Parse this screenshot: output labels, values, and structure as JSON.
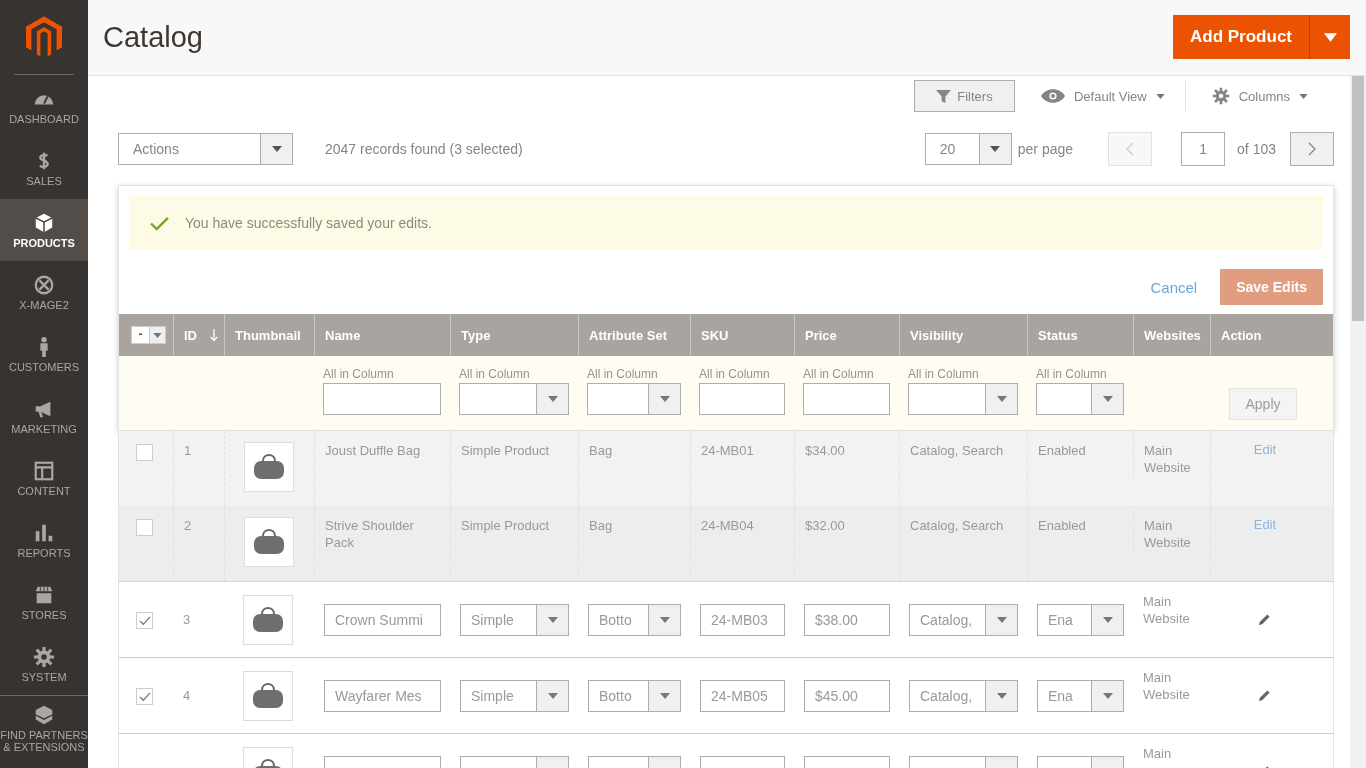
{
  "sidebar": {
    "items": [
      {
        "label": "DASHBOARD",
        "selected": false
      },
      {
        "label": "SALES",
        "selected": false
      },
      {
        "label": "PRODUCTS",
        "selected": true
      },
      {
        "label": "X-MAGE2",
        "selected": false
      },
      {
        "label": "CUSTOMERS",
        "selected": false
      },
      {
        "label": "MARKETING",
        "selected": false
      },
      {
        "label": "CONTENT",
        "selected": false
      },
      {
        "label": "REPORTS",
        "selected": false
      },
      {
        "label": "STORES",
        "selected": false
      },
      {
        "label": "SYSTEM",
        "selected": false
      },
      {
        "label": "FIND PARTNERS & EXTENSIONS",
        "selected": false
      }
    ]
  },
  "header": {
    "title": "Catalog",
    "add_button": "Add Product"
  },
  "toolbar": {
    "filters": "Filters",
    "view": "Default View",
    "columns": "Columns"
  },
  "actions": {
    "placeholder": "Actions",
    "records": "2047 records found (3 selected)"
  },
  "pager": {
    "per_page": "20",
    "per_page_label": "per page",
    "prev_disabled": true,
    "page": "1",
    "of": "of 103"
  },
  "edit_panel": {
    "message": "You have successfully saved your edits.",
    "cancel": "Cancel",
    "save": "Save Edits"
  },
  "grid": {
    "mass_select": "-",
    "apply": "Apply",
    "apply_disabled": true,
    "columns": [
      {
        "label": "ID",
        "sorted": true,
        "kind": "plain"
      },
      {
        "label": "Thumbnail",
        "sorted": false,
        "kind": "plain"
      },
      {
        "label": "Name",
        "sorted": false,
        "kind": "text",
        "filter_label": "All in Column"
      },
      {
        "label": "Type",
        "sorted": false,
        "kind": "select",
        "filter_label": "All in Column"
      },
      {
        "label": "Attribute Set",
        "sorted": false,
        "kind": "select",
        "filter_label": "All in Column"
      },
      {
        "label": "SKU",
        "sorted": false,
        "kind": "text",
        "filter_label": "All in Column"
      },
      {
        "label": "Price",
        "sorted": false,
        "kind": "text",
        "filter_label": "All in Column"
      },
      {
        "label": "Visibility",
        "sorted": false,
        "kind": "select",
        "filter_label": "All in Column"
      },
      {
        "label": "Status",
        "sorted": false,
        "kind": "select",
        "filter_label": "All in Column"
      },
      {
        "label": "Websites",
        "sorted": false,
        "kind": "plain"
      },
      {
        "label": "Action",
        "sorted": false,
        "kind": "plain"
      }
    ],
    "rows": [
      {
        "kind": "view",
        "checked": false,
        "id": "1",
        "cells": [
          "Joust Duffle Bag",
          "Simple Product",
          "Bag",
          "24-MB01",
          "$34.00",
          "Catalog, Search",
          "Enabled"
        ],
        "websites": "Main Website",
        "action": "Edit"
      },
      {
        "kind": "view",
        "checked": false,
        "id": "2",
        "cells": [
          "Strive Shoulder Pack",
          "Simple Product",
          "Bag",
          "24-MB04",
          "$32.00",
          "Catalog, Search",
          "Enabled"
        ],
        "websites": "Main Website",
        "action": "Edit"
      },
      {
        "kind": "edit",
        "checked": true,
        "id": "3",
        "cells": [
          "Crown Summi",
          "Simple",
          "Botto",
          "24-MB03",
          "$38.00",
          "Catalog,",
          "Ena"
        ],
        "websites": "Main Website"
      },
      {
        "kind": "edit",
        "checked": true,
        "id": "4",
        "cells": [
          "Wayfarer Mes",
          "Simple",
          "Botto",
          "24-MB05",
          "$45.00",
          "Catalog,",
          "Ena"
        ],
        "websites": "Main Website"
      },
      {
        "kind": "edit",
        "websites": "Main"
      }
    ]
  }
}
